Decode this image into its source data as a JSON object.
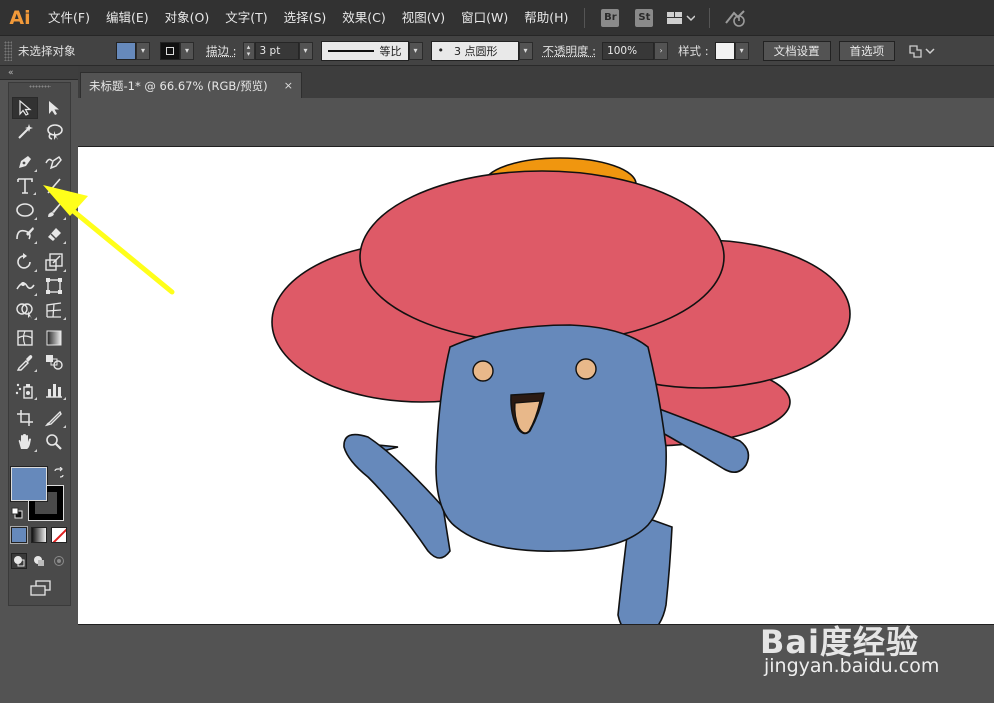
{
  "app": {
    "logo": "Ai",
    "menu": [
      "文件(F)",
      "编辑(E)",
      "对象(O)",
      "文字(T)",
      "选择(S)",
      "效果(C)",
      "视图(V)",
      "窗口(W)",
      "帮助(H)"
    ],
    "bridge_badge": "Br",
    "stock_badge": "St",
    "workspace_icon": "layout-grid-icon",
    "sync_icon": "gpu-performance-icon"
  },
  "control_bar": {
    "selection_status": "未选择对象",
    "fill_color": "#6689bb",
    "stroke_label": "描边 :",
    "stroke_weight": "3 pt",
    "stroke_profile": "等比",
    "brush_definition": "3 点圆形",
    "brush_dot": "•",
    "opacity_label": "不透明度 :",
    "opacity_value": "100%",
    "style_label": "样式 :",
    "doc_setup_button": "文档设置",
    "preferences_button": "首选项"
  },
  "document": {
    "tab_title": "未标题-1* @ 66.67% (RGB/预览)",
    "close_glyph": "×"
  },
  "tools": {
    "active_tool": "type-tool",
    "fill_color": "#6689bb",
    "stroke_color": "#000000"
  },
  "artwork": {
    "petal_color": "#de5a67",
    "body_color": "#6689bb",
    "bud_color": "#f0960f",
    "eye_color": "#e8b88a",
    "mouth_color": "#2b1a12",
    "tongue_color": "#e8b88a"
  },
  "annotation": {
    "arrow_color": "#ffff1a"
  },
  "watermark": {
    "logo_text": "Bai度经验",
    "url": "jingyan.baidu.com"
  }
}
